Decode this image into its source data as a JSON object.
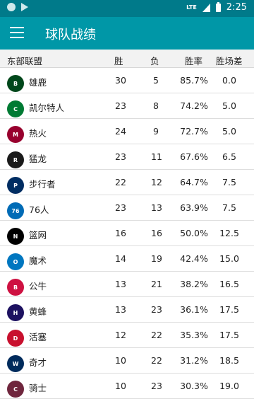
{
  "status_bar": {
    "network": "LTE",
    "time": "2:25"
  },
  "app_bar": {
    "title": "球队战绩"
  },
  "table": {
    "headers": {
      "conference": "东部联盟",
      "wins": "胜",
      "losses": "负",
      "pct": "胜率",
      "gb": "胜场差"
    },
    "rows": [
      {
        "team": "雄鹿",
        "wins": "30",
        "losses": "5",
        "pct": "85.7%",
        "gb": "0.0",
        "logo_icon": "bucks-logo-icon",
        "color": "#00471b",
        "logo_text": "B"
      },
      {
        "team": "凯尔特人",
        "wins": "23",
        "losses": "8",
        "pct": "74.2%",
        "gb": "5.0",
        "logo_icon": "celtics-logo-icon",
        "color": "#007a33",
        "logo_text": "C"
      },
      {
        "team": "热火",
        "wins": "24",
        "losses": "9",
        "pct": "72.7%",
        "gb": "5.0",
        "logo_icon": "heat-logo-icon",
        "color": "#98002e",
        "logo_text": "M"
      },
      {
        "team": "猛龙",
        "wins": "23",
        "losses": "11",
        "pct": "67.6%",
        "gb": "6.5",
        "logo_icon": "raptors-logo-icon",
        "color": "#1a1a1a",
        "logo_text": "R"
      },
      {
        "team": "步行者",
        "wins": "22",
        "losses": "12",
        "pct": "64.7%",
        "gb": "7.5",
        "logo_icon": "pacers-logo-icon",
        "color": "#002d62",
        "logo_text": "P"
      },
      {
        "team": "76人",
        "wins": "23",
        "losses": "13",
        "pct": "63.9%",
        "gb": "7.5",
        "logo_icon": "sixers-logo-icon",
        "color": "#006bb6",
        "logo_text": "76"
      },
      {
        "team": "篮网",
        "wins": "16",
        "losses": "16",
        "pct": "50.0%",
        "gb": "12.5",
        "logo_icon": "nets-logo-icon",
        "color": "#000000",
        "logo_text": "N"
      },
      {
        "team": "魔术",
        "wins": "14",
        "losses": "19",
        "pct": "42.4%",
        "gb": "15.0",
        "logo_icon": "magic-logo-icon",
        "color": "#0077c0",
        "logo_text": "O"
      },
      {
        "team": "公牛",
        "wins": "13",
        "losses": "21",
        "pct": "38.2%",
        "gb": "16.5",
        "logo_icon": "bulls-logo-icon",
        "color": "#ce1141",
        "logo_text": "B"
      },
      {
        "team": "黄蜂",
        "wins": "13",
        "losses": "23",
        "pct": "36.1%",
        "gb": "17.5",
        "logo_icon": "hornets-logo-icon",
        "color": "#1d1160",
        "logo_text": "H"
      },
      {
        "team": "活塞",
        "wins": "12",
        "losses": "22",
        "pct": "35.3%",
        "gb": "17.5",
        "logo_icon": "pistons-logo-icon",
        "color": "#c8102e",
        "logo_text": "D"
      },
      {
        "team": "奇才",
        "wins": "10",
        "losses": "22",
        "pct": "31.2%",
        "gb": "18.5",
        "logo_icon": "wizards-logo-icon",
        "color": "#002b5c",
        "logo_text": "W"
      },
      {
        "team": "骑士",
        "wins": "10",
        "losses": "23",
        "pct": "30.3%",
        "gb": "19.0",
        "logo_icon": "cavaliers-logo-icon",
        "color": "#6f263d",
        "logo_text": "C"
      }
    ]
  },
  "colors": {
    "status_bar": "#007a8a",
    "app_bar": "#0097a7",
    "header_bg": "#f2f2f2"
  }
}
